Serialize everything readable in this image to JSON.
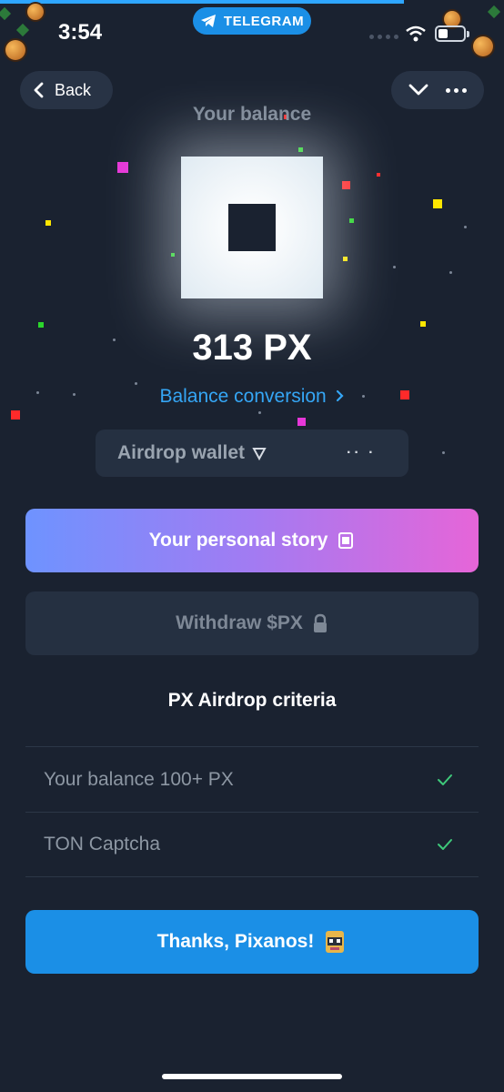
{
  "status_bar": {
    "time": "3:54",
    "app_badge": "TELEGRAM"
  },
  "header": {
    "back_label": "Back"
  },
  "balance": {
    "title": "Your balance",
    "amount": "313 PX",
    "conversion_link": "Balance conversion",
    "wallet_label": "Airdrop wallet",
    "wallet_masked": "·· ·"
  },
  "actions": {
    "story_label": "Your personal story",
    "withdraw_label": "Withdraw $PX",
    "thanks_label": "Thanks, Pixanos!"
  },
  "criteria": {
    "title": "PX Airdrop criteria",
    "items": [
      {
        "label": "Your balance 100+ PX",
        "met": true
      },
      {
        "label": "TON Captcha",
        "met": true
      }
    ]
  },
  "colors": {
    "background": "#1a2230",
    "accent_blue": "#1b8fe6",
    "link_blue": "#35a6f5",
    "check_green": "#3ec97a"
  },
  "icons": [
    "telegram-icon",
    "wifi-icon",
    "battery-icon",
    "chevron-left-icon",
    "chevron-down-icon",
    "more-icon",
    "chevron-right-icon",
    "story-icon",
    "lock-icon",
    "check-icon",
    "pixel-character-icon"
  ]
}
